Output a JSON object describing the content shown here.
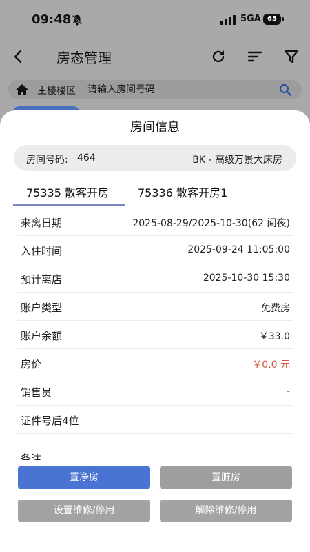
{
  "status_bar": {
    "time": "09:48",
    "network": "5GA",
    "battery": "65"
  },
  "nav": {
    "title": "房态管理"
  },
  "search": {
    "building": "主楼楼区",
    "placeholder": "请输入房间号码"
  },
  "sheet": {
    "title": "房间信息",
    "room_number_label": "房间号码:",
    "room_number": "464",
    "room_type": "BK - 高级万景大床房",
    "tabs": [
      {
        "label": "75335 散客开房",
        "active": true
      },
      {
        "label": "75336 散客开房1",
        "active": false
      }
    ],
    "rows": [
      {
        "label": "来离日期",
        "value": "2025-08-29/2025-10-30(62 间夜)"
      },
      {
        "label": "入住时间",
        "value": "2025-09-24 11:05:00"
      },
      {
        "label": "预计离店",
        "value": "2025-10-30 15:30"
      },
      {
        "label": "账户类型",
        "value": "免费房"
      },
      {
        "label": "账户余额",
        "value": "￥33.0"
      },
      {
        "label": "房价",
        "value": "￥0.0 元"
      },
      {
        "label": "销售员",
        "value": "-"
      },
      {
        "label": "证件号后4位",
        "value": ""
      }
    ],
    "remark_label": "备注"
  },
  "actions": {
    "set_clean": "置净房",
    "set_dirty": "置脏房",
    "set_maintenance": "设置维修/停用",
    "clear_maintenance": "解除维修/停用"
  },
  "colors": {
    "primary": "#4a74d3",
    "price": "#d2573c",
    "disabled": "#9e9e9e"
  }
}
